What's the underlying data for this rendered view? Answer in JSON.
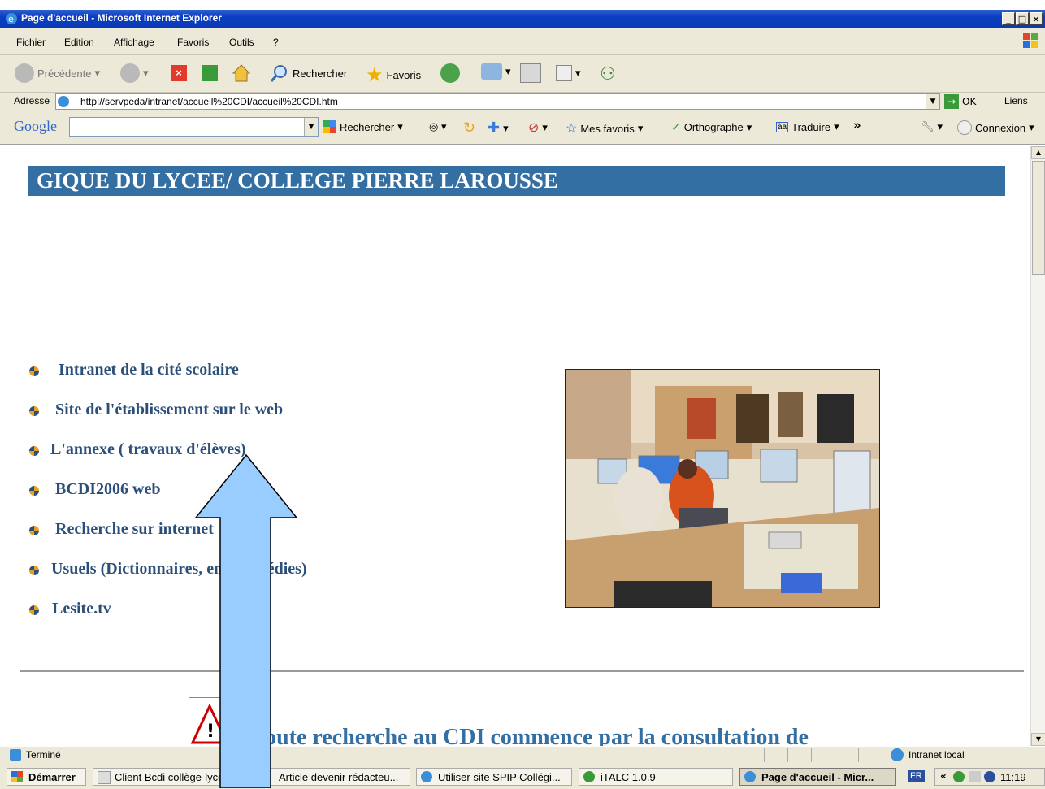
{
  "window": {
    "title": "Page d'accueil - Microsoft Internet Explorer",
    "min": "_",
    "max": "□",
    "close": "×"
  },
  "menu": [
    "Fichier",
    "Edition",
    "Affichage",
    "Favoris",
    "Outils",
    "?"
  ],
  "toolbar": {
    "back": "Précédente",
    "search": "Rechercher",
    "favorites": "Favoris"
  },
  "address": {
    "label": "Adresse",
    "url": "http://servpeda/intranet/accueil%20CDI/accueil%20CDI.htm",
    "go": "OK",
    "links": "Liens"
  },
  "google": {
    "logo": "Google",
    "search": "Rechercher",
    "favorites": "Mes favoris",
    "spell": "Orthographe",
    "translate": "Traduire",
    "more": "»",
    "signin": "Connexion"
  },
  "page": {
    "banner": "GIQUE DU LYCEE/ COLLEGE PIERRE LAROUSSE",
    "links": [
      "Intranet de la cité scolaire",
      "Site de l'établissement sur le web",
      "L'annexe ( travaux d'élèves)",
      "BCDI2006 web",
      "Recherche sur internet",
      "Usuels (Dictionnaires, encyclopédies)",
      "Lesite.tv"
    ],
    "footer": "Toute recherche au CDI commence par la consultation de"
  },
  "status": {
    "text": "Terminé",
    "zone": "Intranet local"
  },
  "taskbar": {
    "start": "Démarrer",
    "tasks": [
      "Client Bcdi collège-lycée",
      "Article devenir rédacteu...",
      "Utiliser site SPIP Collégi...",
      "iTALC 1.0.9",
      "Page d'accueil - Micr..."
    ],
    "lang": "FR",
    "clock": "11:19"
  },
  "colors": {
    "banner": "#336fa3",
    "link": "#2c4f79",
    "arrow": "#99ccff"
  }
}
